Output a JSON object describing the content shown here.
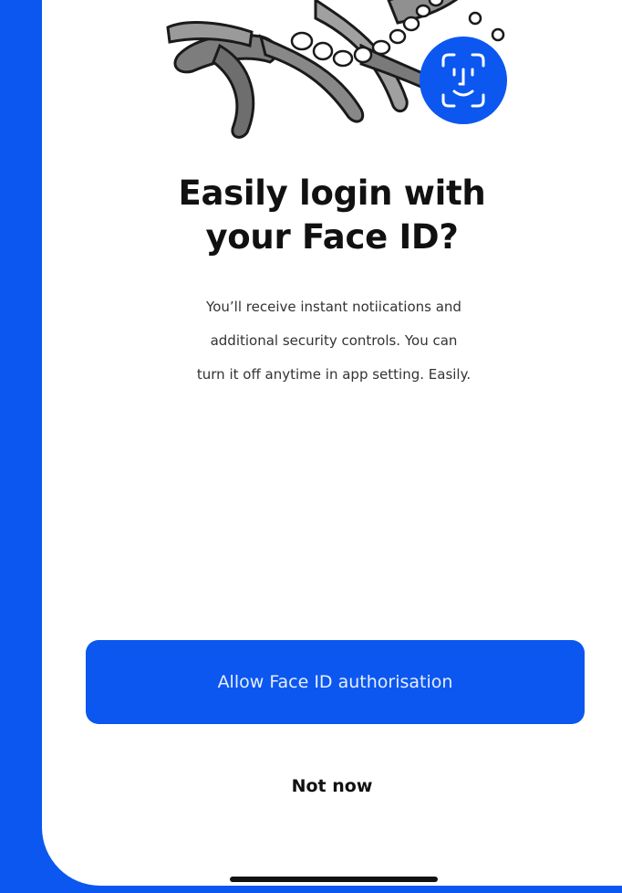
{
  "colors": {
    "background": "#0b57f0",
    "accent": "#0b57f0",
    "card": "#ffffff",
    "text": "#111111"
  },
  "illustration": {
    "subject": "octopus-illustration",
    "badge_icon": "face-id-icon"
  },
  "heading": {
    "line1": "Easily login with",
    "line2": "your Face ID?"
  },
  "description": {
    "line1": "You’ll receive instant notiications and",
    "line2": "additional security controls. You can",
    "line3": "turn it off anytime in app setting. Easily."
  },
  "actions": {
    "primary_label": "Allow Face ID authorisation",
    "secondary_label": "Not now"
  }
}
